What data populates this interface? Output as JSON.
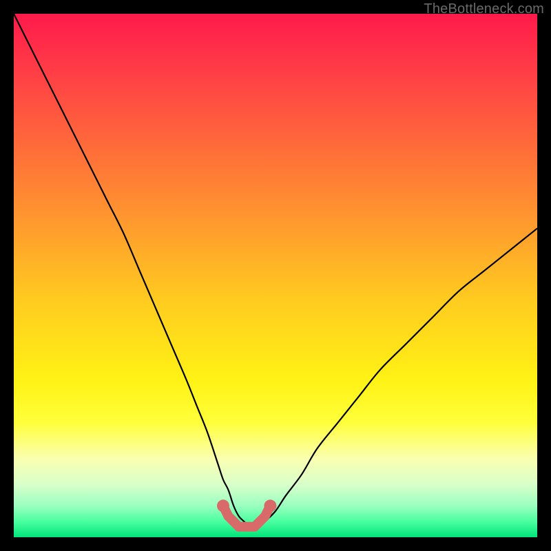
{
  "attribution": "TheBottleneck.com",
  "chart_data": {
    "type": "line",
    "title": "",
    "xlabel": "",
    "ylabel": "",
    "xlim": [
      0,
      100
    ],
    "ylim": [
      0,
      100
    ],
    "grid": false,
    "series": [
      {
        "name": "bottleneck-curve",
        "x": [
          0,
          3,
          6,
          9,
          12,
          15,
          18,
          21,
          24,
          27,
          30,
          33,
          35,
          37,
          39,
          40,
          41,
          42,
          43,
          44,
          45,
          46,
          47,
          48,
          50,
          52,
          55,
          58,
          62,
          66,
          70,
          75,
          80,
          85,
          90,
          95,
          100
        ],
        "y": [
          100,
          94,
          88,
          82,
          76,
          70,
          64,
          58,
          51,
          44,
          37,
          30,
          25,
          20,
          14,
          11,
          9,
          6,
          4,
          3,
          2,
          2,
          2,
          3,
          5,
          8,
          12,
          17,
          22,
          27,
          32,
          37,
          42,
          47,
          51,
          55,
          59
        ]
      },
      {
        "name": "sweet-spot-markers",
        "x": [
          40,
          41,
          42,
          43,
          44,
          45,
          46,
          47,
          48,
          49
        ],
        "y": [
          6,
          4,
          3,
          2,
          2,
          2,
          2,
          3,
          4,
          6
        ]
      }
    ],
    "gradient_stops": [
      {
        "offset": 0.0,
        "color": "#ff1a4b"
      },
      {
        "offset": 0.1,
        "color": "#ff3a47"
      },
      {
        "offset": 0.25,
        "color": "#ff6a3a"
      },
      {
        "offset": 0.4,
        "color": "#ff9a2e"
      },
      {
        "offset": 0.55,
        "color": "#ffcc1f"
      },
      {
        "offset": 0.7,
        "color": "#fff215"
      },
      {
        "offset": 0.78,
        "color": "#ffff3a"
      },
      {
        "offset": 0.85,
        "color": "#faffb0"
      },
      {
        "offset": 0.9,
        "color": "#d8ffca"
      },
      {
        "offset": 0.94,
        "color": "#9affc0"
      },
      {
        "offset": 0.97,
        "color": "#4affa0"
      },
      {
        "offset": 1.0,
        "color": "#00e57a"
      }
    ],
    "marker_color": "#d96a6a",
    "curve_color": "#000000"
  }
}
